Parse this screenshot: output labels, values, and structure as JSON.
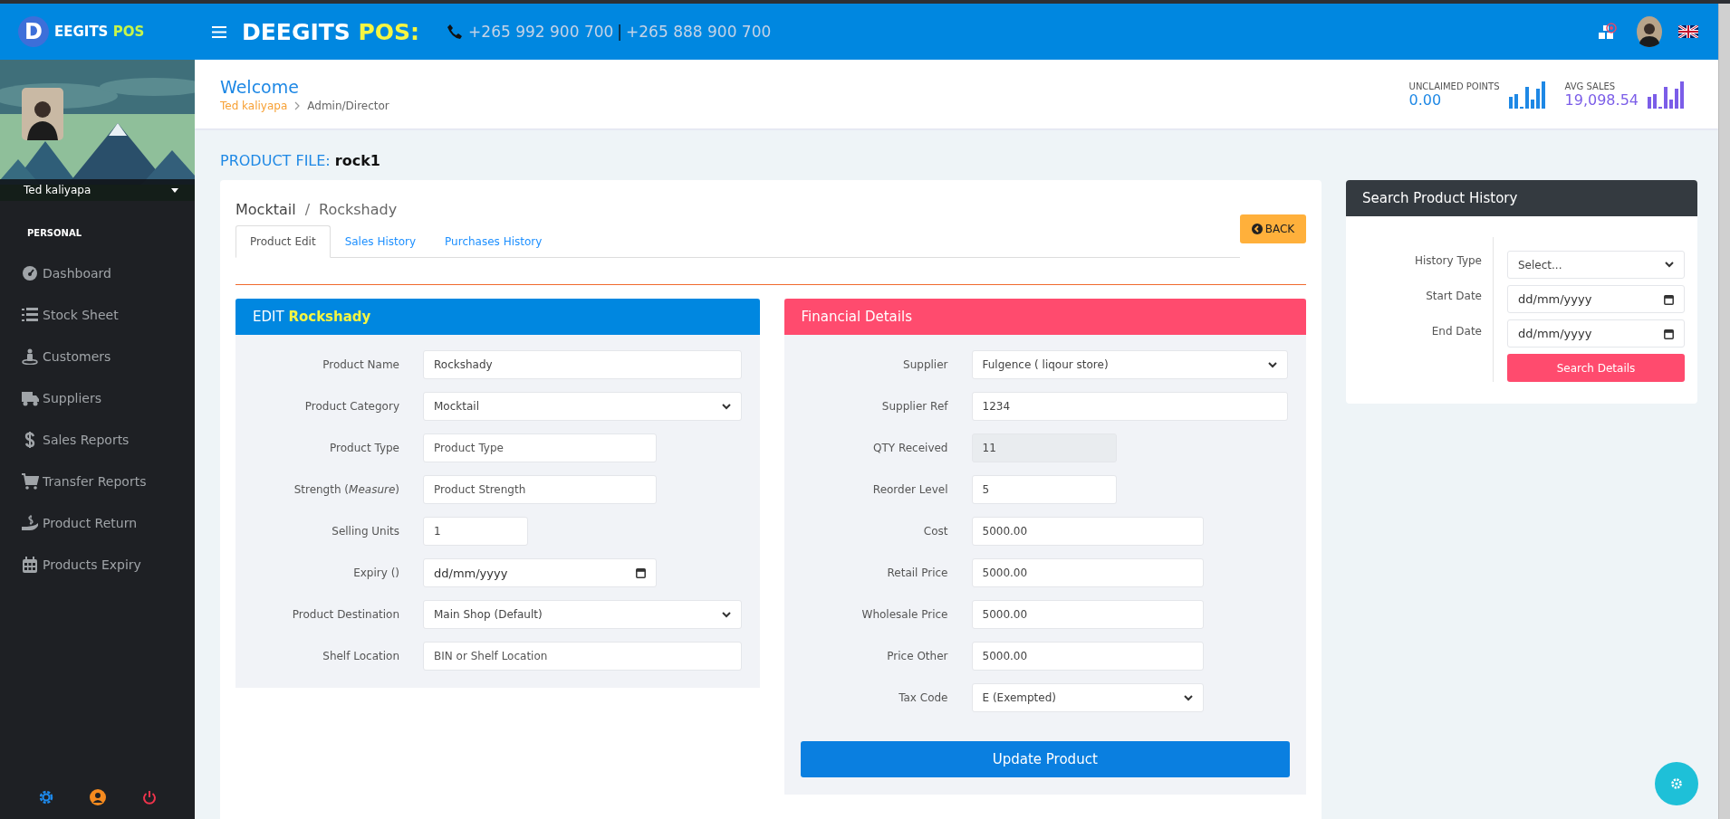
{
  "top_bar": {
    "logo_letter": "D",
    "brand": "EEGITS",
    "brand_accent": "POS",
    "title": "DEEGITS",
    "title_accent": "POS:",
    "phones": [
      "+265 992 900 700",
      "+265 888 900 700"
    ],
    "phone_separator": "|"
  },
  "sidebar": {
    "user_name": "Ted kaliyapa",
    "section": "PERSONAL",
    "items": [
      {
        "label": "Dashboard",
        "kind": "dashboard"
      },
      {
        "label": "Stock Sheet",
        "kind": "list"
      },
      {
        "label": "Customers",
        "kind": "person"
      },
      {
        "label": "Suppliers",
        "kind": "truck"
      },
      {
        "label": "Sales Reports",
        "kind": "dollar"
      },
      {
        "label": "Transfer Reports",
        "kind": "cart"
      },
      {
        "label": "Product Return",
        "kind": "hand"
      },
      {
        "label": "Products Expiry",
        "kind": "calendar"
      }
    ]
  },
  "header": {
    "title": "Welcome",
    "user": "Ted kaliyapa",
    "role": "Admin/Director",
    "stats": [
      {
        "label": "UNCLAIMED POINTS",
        "value": "0.00",
        "color": "#1e88e5"
      },
      {
        "label": "AVG SALES",
        "value": "19,098.54",
        "color": "#7b5de8"
      }
    ]
  },
  "page": {
    "title_label": "PRODUCT FILE:",
    "title_value": "rock1"
  },
  "product_card": {
    "breadcrumb": [
      "Mocktail",
      "Rockshady"
    ],
    "breadcrumb_separator": "/",
    "tabs": [
      {
        "label": "Product Edit",
        "selected": true
      },
      {
        "label": "Sales History",
        "selected": false
      },
      {
        "label": "Purchases History",
        "selected": false
      }
    ],
    "back_button": "BACK",
    "edit_panel": {
      "title": "EDIT",
      "title_accent": "Rockshady",
      "fields": [
        {
          "label": "Product Name",
          "kind": "text",
          "value": "Rockshady",
          "disabled": false
        },
        {
          "label": "Product Category",
          "kind": "select",
          "value": "Mocktail",
          "disabled": false
        },
        {
          "label": "Product Type",
          "kind": "text",
          "placeholder": "Product Type",
          "disabled": false
        },
        {
          "label": "Strength (*Measure*)",
          "kind": "text",
          "placeholder": "Product Strength",
          "disabled": false
        },
        {
          "label": "Selling Units",
          "kind": "text",
          "value": "1",
          "disabled": false
        },
        {
          "label": "Expiry ()",
          "kind": "date",
          "placeholder": "dd/mm/yyyy",
          "disabled": false
        },
        {
          "label": "Product Destination",
          "kind": "select",
          "value": "Main Shop (Default)",
          "disabled": false
        },
        {
          "label": "Shelf Location",
          "kind": "text",
          "placeholder": "BIN or Shelf Location",
          "disabled": false
        }
      ]
    },
    "financial_panel": {
      "title": "Financial Details",
      "fields": [
        {
          "label": "Supplier",
          "kind": "select",
          "value": "Fulgence ( liqour store)",
          "disabled": false
        },
        {
          "label": "Supplier Ref",
          "kind": "text",
          "value": "1234",
          "disabled": false
        },
        {
          "label": "QTY Received",
          "kind": "text",
          "value": "11",
          "disabled": true
        },
        {
          "label": "Reorder Level",
          "kind": "text",
          "value": "5",
          "disabled": false
        },
        {
          "label": "Cost",
          "kind": "text",
          "value": "5000.00",
          "disabled": false
        },
        {
          "label": "Retail Price",
          "kind": "text",
          "value": "5000.00",
          "disabled": false
        },
        {
          "label": "Wholesale Price",
          "kind": "text",
          "value": "5000.00",
          "disabled": false
        },
        {
          "label": "Price Other",
          "kind": "text",
          "value": "5000.00",
          "disabled": false
        },
        {
          "label": "Tax Code",
          "kind": "select",
          "value": "E (Exempted)",
          "disabled": false
        }
      ],
      "submit_button": "Update Product"
    }
  },
  "search_panel": {
    "title": "Search Product History",
    "fields": [
      {
        "label": "History Type",
        "kind": "select",
        "value": "Select...",
        "disabled": false
      },
      {
        "label": "Start Date",
        "kind": "date",
        "placeholder": "dd/mm/yyyy",
        "disabled": false
      },
      {
        "label": "End Date",
        "kind": "date",
        "placeholder": "dd/mm/yyyy",
        "disabled": false
      }
    ],
    "button": "Search Details"
  }
}
